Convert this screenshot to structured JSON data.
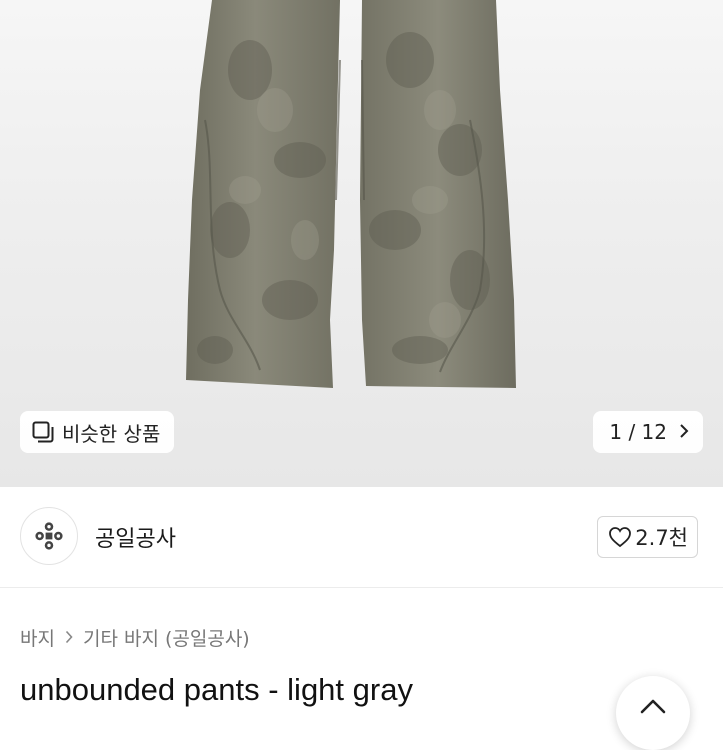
{
  "gallery": {
    "similar_label": "비슷한 상품",
    "counter": "1 / 12"
  },
  "seller": {
    "name": "공일공사",
    "likes": "2.7천"
  },
  "breadcrumb": [
    "바지",
    "기타 바지 (공일공사)"
  ],
  "product": {
    "title": "unbounded pants - light gray"
  },
  "colors": {
    "pants": "#7b7a6c",
    "background": "#eeeeee"
  }
}
